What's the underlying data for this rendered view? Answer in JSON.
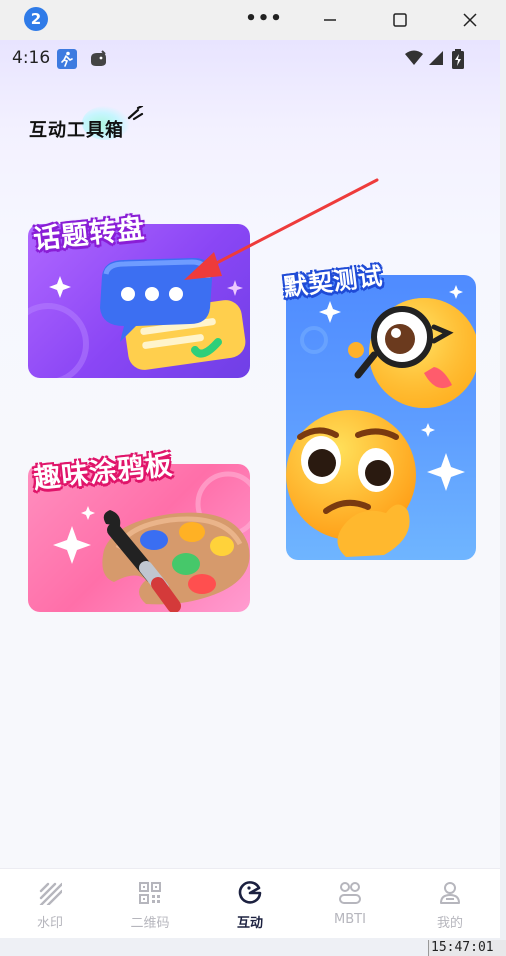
{
  "window": {
    "badge": "2",
    "more_label": "•••"
  },
  "status_bar": {
    "time": "4:16"
  },
  "page": {
    "title": "互动工具箱"
  },
  "cards": {
    "topic_wheel": {
      "label": "话题转盘"
    },
    "tacit_test": {
      "label": "默契测试"
    },
    "doodle_board": {
      "label": "趣味涂鸦板"
    }
  },
  "bottom_nav": {
    "items": [
      {
        "label": "水印",
        "icon": "watermark-icon",
        "active": false
      },
      {
        "label": "二维码",
        "icon": "qr-code-icon",
        "active": false
      },
      {
        "label": "互动",
        "icon": "interact-icon",
        "active": true
      },
      {
        "label": "MBTI",
        "icon": "mbti-icon",
        "active": false
      },
      {
        "label": "我的",
        "icon": "profile-icon",
        "active": false
      }
    ]
  },
  "taskbar": {
    "clock": "15:47:01"
  },
  "colors": {
    "accent_nav_active": "#1c2140",
    "nav_inactive": "#b6b6bd",
    "topic_card": "#8a46f5",
    "doodle_card": "#ff6fa9",
    "tacit_card": "#4f8bff",
    "annotation_arrow": "#ee3b3b"
  }
}
